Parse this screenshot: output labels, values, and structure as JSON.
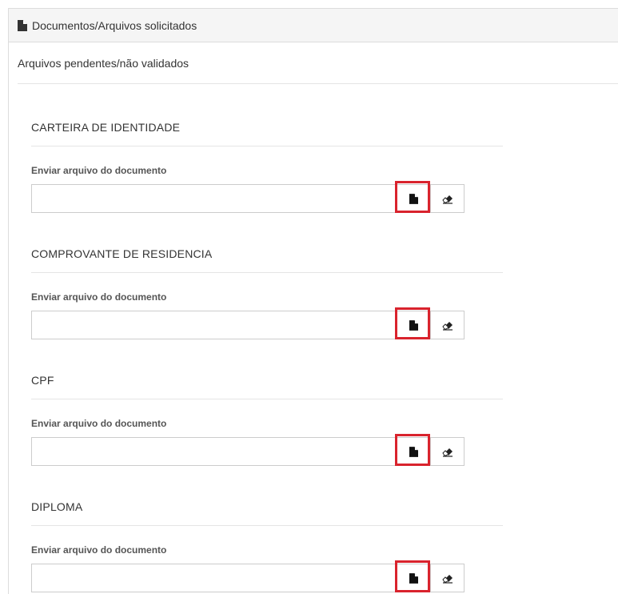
{
  "panel": {
    "heading": "Documentos/Arquivos solicitados",
    "heading_icon": "file-icon"
  },
  "section": {
    "title": "Arquivos pendentes/não validados"
  },
  "documents": [
    {
      "name": "CARTEIRA DE IDENTIDADE",
      "upload_label": "Enviar arquivo do documento",
      "file_value": ""
    },
    {
      "name": "COMPROVANTE DE RESIDENCIA",
      "upload_label": "Enviar arquivo do documento",
      "file_value": ""
    },
    {
      "name": "CPF",
      "upload_label": "Enviar arquivo do documento",
      "file_value": ""
    },
    {
      "name": "DIPLOMA",
      "upload_label": "Enviar arquivo do documento",
      "file_value": ""
    }
  ],
  "icons": {
    "select_file": "file-icon",
    "clear": "eraser-icon"
  },
  "colors": {
    "highlight": "#d9232d",
    "heading_bg": "#f5f5f5"
  }
}
